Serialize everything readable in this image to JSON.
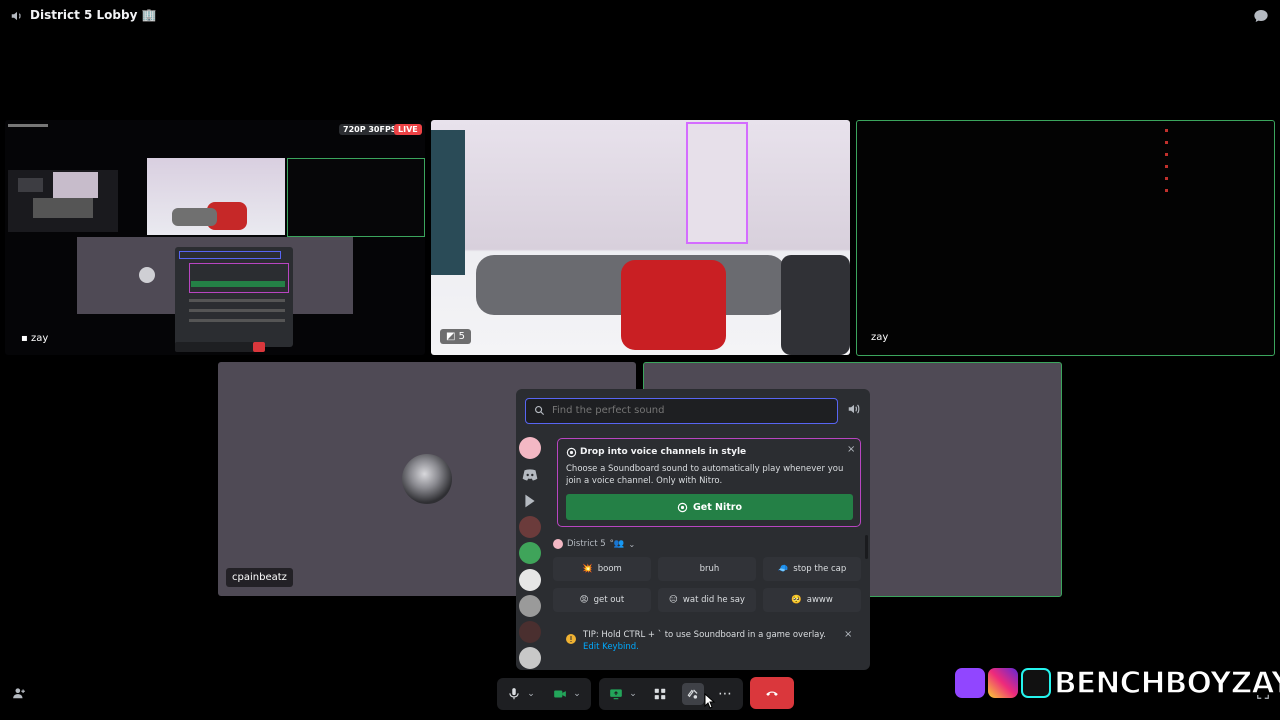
{
  "header": {
    "title": "District 5 Lobby",
    "title_emoji": "🏢",
    "speaker_icon": "speaker-icon",
    "chat_icon": "chat-bubble-icon"
  },
  "tiles": {
    "stream": {
      "label": "zay",
      "resolution_badge": "720P 30FPS",
      "live_badge": "LIVE"
    },
    "cam": {
      "label_count": "5"
    },
    "dark": {
      "label": "zay"
    },
    "cpain": {
      "label": "cpainbeatz"
    }
  },
  "soundboard": {
    "search_placeholder": "Find the perfect sound",
    "nitro_promo": {
      "title": "Drop into voice channels in style",
      "body": "Choose a Soundboard sound to automatically play whenever you join a voice channel. Only with Nitro.",
      "button": "Get Nitro",
      "close": "×"
    },
    "section": {
      "name": "District 5",
      "suffix": "°👥"
    },
    "sounds": [
      {
        "label": "boom",
        "emoji": "💥"
      },
      {
        "label": "bruh",
        "emoji": ""
      },
      {
        "label": "stop the cap",
        "emoji": "🧢"
      },
      {
        "label": "get out",
        "emoji": "😡"
      },
      {
        "label": "wat did he say",
        "emoji": "😑"
      },
      {
        "label": "awww",
        "emoji": "🥺"
      }
    ],
    "tip": {
      "text": "TIP: Hold CTRL + ` to use Soundboard in a game overlay.",
      "link": "Edit Keybind.",
      "close": "×"
    }
  },
  "watermark": {
    "text": "BENCHBOYZAY"
  },
  "colors": {
    "accent": "#5865f2",
    "nitro_border": "#b845c1",
    "green": "#248046",
    "speaking_border": "#3ba55d",
    "hangup": "#da373c",
    "live": "#ed4245"
  }
}
